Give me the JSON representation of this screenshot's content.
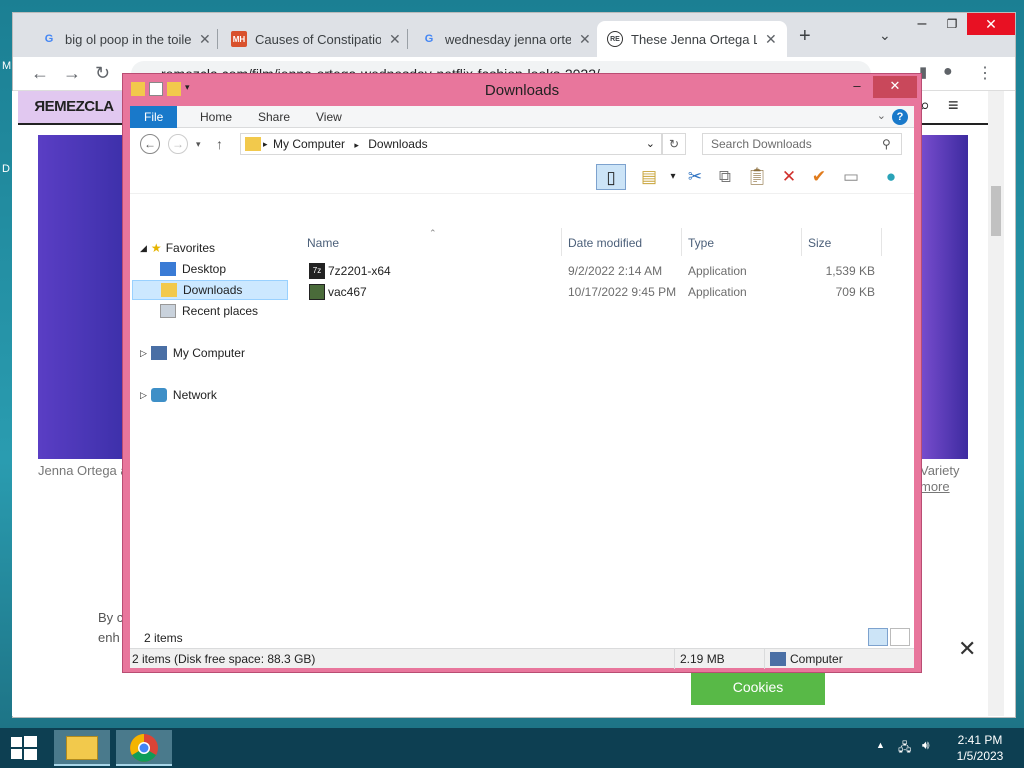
{
  "desktop": {
    "letters": [
      "M",
      "D"
    ]
  },
  "browser": {
    "tabs": [
      {
        "title": "big ol poop in the toile",
        "favicon": "google-g"
      },
      {
        "title": "Causes of Constipation",
        "favicon": "mh"
      },
      {
        "title": "wednesday jenna orteg",
        "favicon": "google-g"
      },
      {
        "title": "These Jenna Ortega Loo",
        "favicon": "remezcla"
      }
    ],
    "favicon_mh_text": "MH",
    "favicon_re_text": "RE",
    "url": "remezcla.com/film/jenna-ortega-wednesday-netflix-fashion-looks-2022/",
    "page": {
      "logo": "ЯEMEZCLA",
      "caption_left": "Jenna Ortega at",
      "caption_right_1": "Variety",
      "caption_right_2": "more",
      "by_line_1": "By c",
      "by_line_2": "enh",
      "cookie_button": "Cookies"
    }
  },
  "explorer": {
    "title": "Downloads",
    "ribbon_tabs": [
      "File",
      "Home",
      "Share",
      "View"
    ],
    "breadcrumb": [
      "My Computer",
      "Downloads"
    ],
    "search_placeholder": "Search Downloads",
    "nav": {
      "favorites": "Favorites",
      "desktop": "Desktop",
      "downloads": "Downloads",
      "recent": "Recent places",
      "my_computer": "My Computer",
      "network": "Network"
    },
    "columns": [
      "Name",
      "Date modified",
      "Type",
      "Size"
    ],
    "files": [
      {
        "name": "7z2201-x64",
        "date": "9/2/2022 2:14 AM",
        "type": "Application",
        "size": "1,539 KB"
      },
      {
        "name": "vac467",
        "date": "10/17/2022 9:45 PM",
        "type": "Application",
        "size": "709 KB"
      }
    ],
    "item_count": "2 items",
    "status_left": "2 items (Disk free space: 88.3 GB)",
    "status_size": "2.19 MB",
    "status_location": "Computer"
  },
  "taskbar": {
    "time": "2:41 PM",
    "date": "1/5/2023"
  },
  "colors": {
    "explorer_frame": "#e8769c",
    "ribbon_file": "#1979ca",
    "taskbar": "#0d3f52",
    "cookie_button": "#58b947"
  }
}
